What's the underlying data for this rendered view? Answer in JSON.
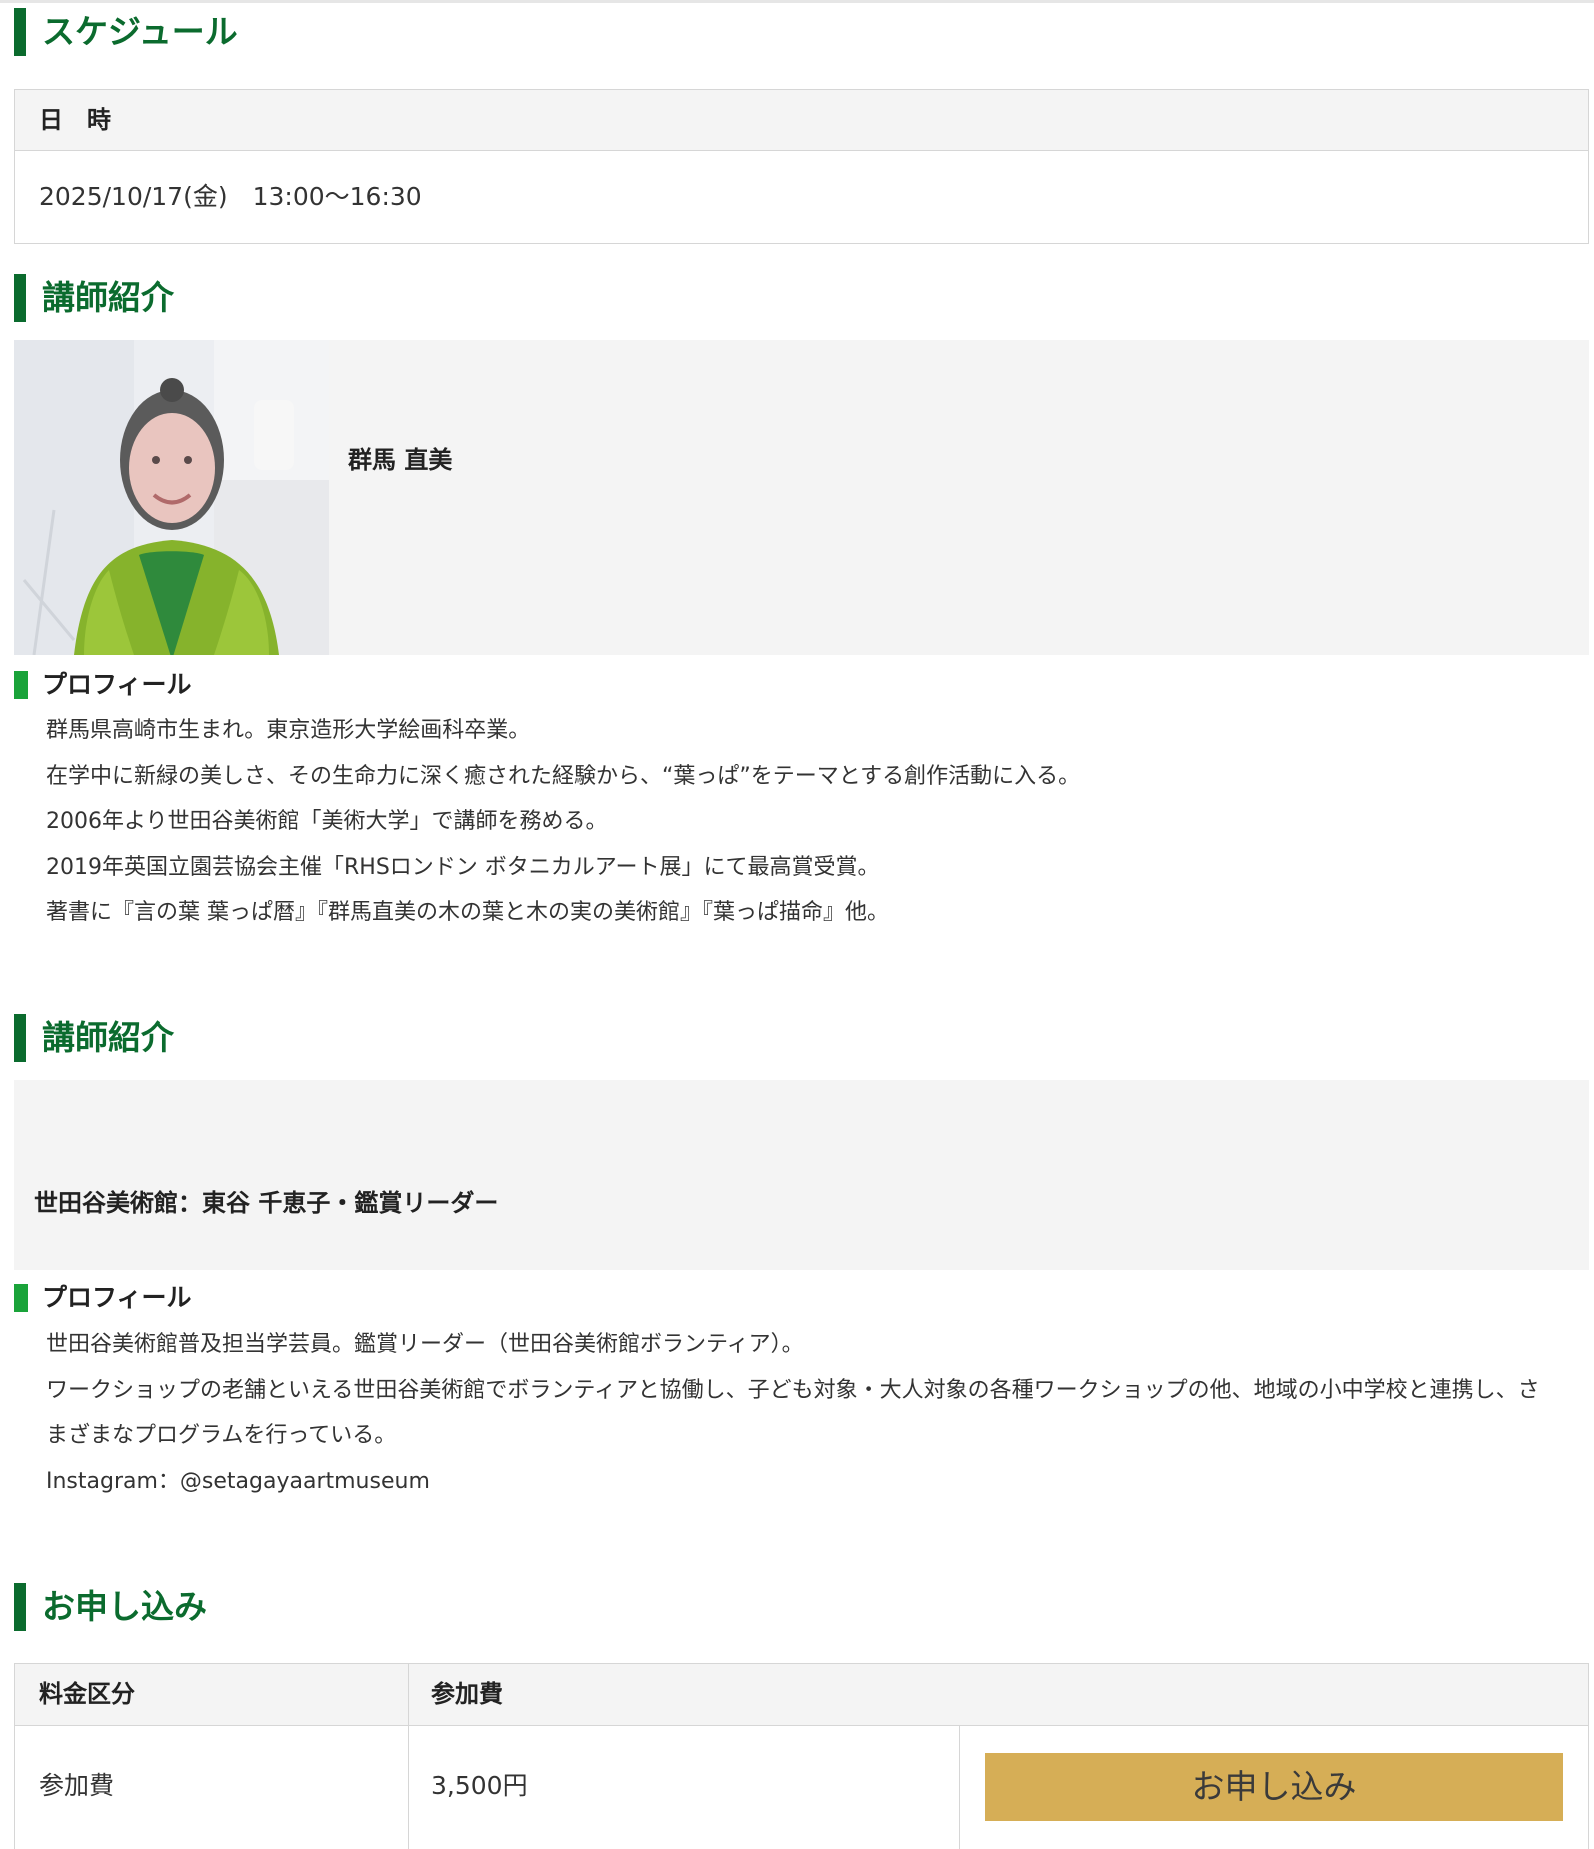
{
  "schedule": {
    "title": "スケジュール",
    "header": "日　時",
    "value": "2025/10/17(金)　13:00〜16:30"
  },
  "instructors": [
    {
      "title": "講師紹介",
      "name": "群馬 直美",
      "profile_title": "プロフィール",
      "profile": [
        "群馬県高崎市生まれ。東京造形大学絵画科卒業。",
        "在学中に新緑の美しさ、その生命力に深く癒された経験から、“葉っぱ”をテーマとする創作活動に入る。",
        "2006年より世田谷美術館「美術大学」で講師を務める。",
        "2019年英国立園芸協会主催「RHSロンドン ボタニカルアート展」にて最高賞受賞。",
        "著書に『言の葉 葉っぱ暦』『群馬直美の木の葉と木の実の美術館』『葉っぱ描命』他。"
      ]
    },
    {
      "title": "講師紹介",
      "name": "世田谷美術館：東谷 千恵子・鑑賞リーダー",
      "profile_title": "プロフィール",
      "profile": [
        "世田谷美術館普及担当学芸員。鑑賞リーダー（世田谷美術館ボランティア）。",
        "ワークショップの老舗といえる世田谷美術館でボランティアと協働し、子ども対象・大人対象の各種ワークショップの他、地域の小中学校と連携し、さ",
        "まざまなプログラムを行っている。",
        "Instagram：@setagayaartmuseum"
      ]
    }
  ],
  "application": {
    "title": "お申し込み",
    "headers": [
      "料金区分",
      "参加費"
    ],
    "row": {
      "category": "参加費",
      "price": "3,500円"
    },
    "button_label": "お申し込み"
  },
  "colors": {
    "heading_green": "#0b6b2e",
    "sub_bar_green": "#1aa33a",
    "button_gold": "#d6ae56",
    "panel_gray": "#f4f4f4"
  }
}
